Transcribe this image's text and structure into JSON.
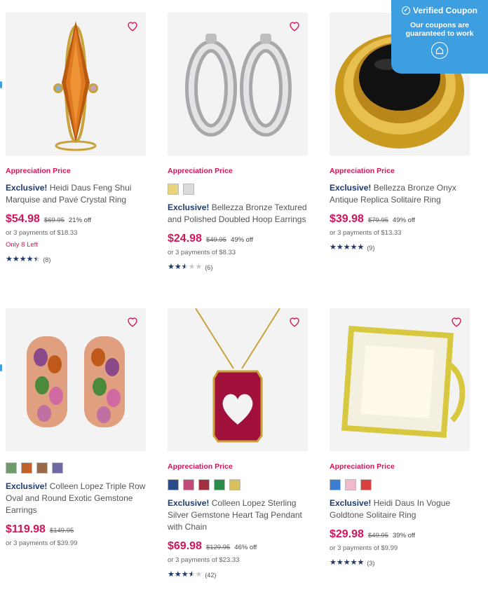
{
  "coupon": {
    "title": "Verified Coupon",
    "subtitle": "Our coupons are guaranteed to work",
    "check_icon": "check-circle-icon",
    "home_icon": "home-icon",
    "color": "#3e9fe0"
  },
  "colors": {
    "accent": "#d4145a",
    "brand": "#1e3a6e"
  },
  "products": [
    {
      "appreciation": "Appreciation Price",
      "exclusive": "Exclusive!",
      "name": "Heidi Daus Feng Shui Marquise and Pavé Crystal Ring",
      "price": "$54.98",
      "original": "$69.95",
      "discount": "21% off",
      "payments": "or 3 payments of $18.33",
      "stock": "Only 8 Left",
      "rating": 4.5,
      "reviews": "(8)",
      "swatches": []
    },
    {
      "appreciation": "Appreciation Price",
      "exclusive": "Exclusive!",
      "name": "Bellezza Bronze Textured and Polished Doubled Hoop Earrings",
      "price": "$24.98",
      "original": "$49.95",
      "discount": "49% off",
      "payments": "or 3 payments of $8.33",
      "stock": "",
      "rating": 2.5,
      "reviews": "(6)",
      "swatches": [
        "#e8d27a",
        "#dcdcdc"
      ]
    },
    {
      "appreciation": "Appreciation Price",
      "exclusive": "Exclusive!",
      "name": "Bellezza Bronze Onyx Antique Replica Solitaire Ring",
      "price": "$39.98",
      "original": "$79.95",
      "discount": "49% off",
      "payments": "or 3 payments of $13.33",
      "stock": "",
      "rating": 5,
      "reviews": "(9)",
      "swatches": []
    },
    {
      "appreciation": "",
      "exclusive": "Exclusive!",
      "name": "Colleen Lopez Triple Row Oval and Round Exotic Gemstone Earrings",
      "price": "$119.98",
      "original": "$149.95",
      "discount": "",
      "payments": "or 3 payments of $39.99",
      "stock": "",
      "rating": null,
      "reviews": "",
      "swatches": [
        "#6f9a6a",
        "#c0622a",
        "#9a6a48",
        "#6e6aa8"
      ]
    },
    {
      "appreciation": "Appreciation Price",
      "exclusive": "Exclusive!",
      "name": "Colleen Lopez Sterling Silver Gemstone Heart Tag Pendant with Chain",
      "price": "$69.98",
      "original": "$129.95",
      "discount": "46% off",
      "payments": "or 3 payments of $23.33",
      "stock": "",
      "rating": 3.5,
      "reviews": "(42)",
      "swatches": [
        "#2a4a8a",
        "#c04a7a",
        "#a03040",
        "#2a8a4a",
        "#d8c060"
      ]
    },
    {
      "appreciation": "Appreciation Price",
      "exclusive": "Exclusive!",
      "name": "Heidi Daus In Vogue Goldtone Solitaire Ring",
      "price": "$29.98",
      "original": "$49.95",
      "discount": "39% off",
      "payments": "or 3 payments of $9.99",
      "stock": "",
      "rating": 5,
      "reviews": "(3)",
      "swatches": [
        "#3a7ed0",
        "#f2b8cc",
        "#d84040"
      ]
    }
  ]
}
